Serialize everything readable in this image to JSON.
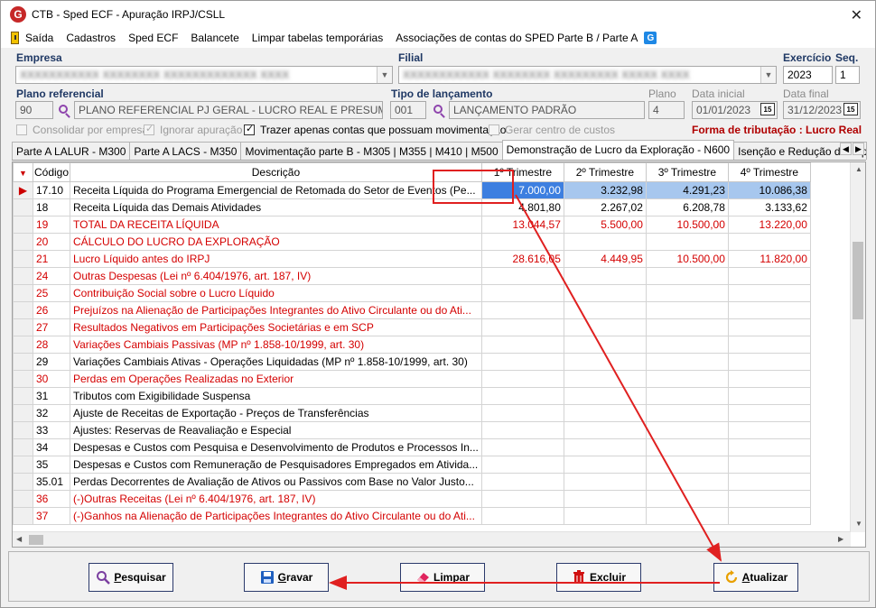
{
  "window": {
    "title": "CTB - Sped ECF - Apuração IRPJ/CSLL",
    "logo_letter": "G",
    "close_glyph": "✕"
  },
  "menu": {
    "items": [
      "Saída",
      "Cadastros",
      "Sped ECF",
      "Balancete",
      "Limpar tabelas temporárias",
      "Associações de contas do SPED Parte B / Parte A"
    ],
    "help_glyph": "G"
  },
  "form": {
    "empresa_label": "Empresa",
    "empresa_value": "XXXXXXXXXXX XXXXXXXX XXXXXXXXXXXXX XXXX",
    "filial_label": "Filial",
    "filial_value": "XXXXXXXXXXXX XXXXXXXX XXXXXXXXX XXXXX XXXX",
    "exercicio_label": "Exercício",
    "exercicio_value": "2023",
    "seq_label": "Seq.",
    "seq_value": "1",
    "plano_label": "Plano referencial",
    "plano_code": "90",
    "plano_desc": "PLANO REFERENCIAL PJ GERAL - LUCRO REAL E PRESUMIDO AN",
    "tipo_label": "Tipo de lançamento",
    "tipo_code": "001",
    "tipo_desc": "LANÇAMENTO PADRÃO",
    "plano2_label": "Plano",
    "plano2_value": "4",
    "data_inicial_label": "Data inicial",
    "data_inicial_value": "01/01/2023",
    "data_final_label": "Data final",
    "data_final_value": "31/12/2023",
    "cal_glyph": "15"
  },
  "checks": [
    {
      "label": "Consolidar por empresa",
      "state": "disabled-empty"
    },
    {
      "label": "Ignorar apuração",
      "state": "disabled-checked"
    },
    {
      "label": "Trazer apenas contas que possuam movimentação",
      "state": "checked"
    },
    {
      "label": "Gerar centro de custos",
      "state": "disabled-empty"
    }
  ],
  "forma_tributacao": "Forma de tributação : Lucro Real",
  "tabs": [
    "Parte A LALUR - M300",
    "Parte A LACS - M350",
    "Movimentação parte B - M305 | M355 | M410 | M500",
    "Demonstração de Lucro da Exploração - N600",
    "Isenção e Redução do Imposto Sobre o"
  ],
  "active_tab": 3,
  "grid": {
    "headers": [
      "Código",
      "Descrição",
      "1º Trimestre",
      "2º Trimestre",
      "3º Trimestre",
      "4º Trimestre"
    ],
    "rows": [
      {
        "code": "17.10",
        "desc": "Receita Líquida do Programa Emergencial de Retomada do Setor de Eventos (Pe...",
        "q1": "7.000,00",
        "q2": "3.232,98",
        "q3": "4.291,23",
        "q4": "10.086,38",
        "red": false,
        "selected": true
      },
      {
        "code": "18",
        "desc": "Receita Líquida das Demais Atividades",
        "q1": "4.801,80",
        "q2": "2.267,02",
        "q3": "6.208,78",
        "q4": "3.133,62",
        "red": false
      },
      {
        "code": "19",
        "desc": "TOTAL DA RECEITA LÍQUIDA",
        "q1": "13.044,57",
        "q2": "5.500,00",
        "q3": "10.500,00",
        "q4": "13.220,00",
        "red": true
      },
      {
        "code": "20",
        "desc": "CÁLCULO DO LUCRO DA EXPLORAÇÃO",
        "q1": "",
        "q2": "",
        "q3": "",
        "q4": "",
        "red": true
      },
      {
        "code": "21",
        "desc": "Lucro Líquido antes do IRPJ",
        "q1": "28.616,05",
        "q2": "4.449,95",
        "q3": "10.500,00",
        "q4": "11.820,00",
        "red": true
      },
      {
        "code": "24",
        "desc": "Outras Despesas (Lei nº 6.404/1976, art. 187, IV)",
        "q1": "",
        "q2": "",
        "q3": "",
        "q4": "",
        "red": true
      },
      {
        "code": "25",
        "desc": "Contribuição Social sobre o Lucro Líquido",
        "q1": "",
        "q2": "",
        "q3": "",
        "q4": "",
        "red": true
      },
      {
        "code": "26",
        "desc": "Prejuízos na Alienação de Participações Integrantes do Ativo Circulante ou do Ati...",
        "q1": "",
        "q2": "",
        "q3": "",
        "q4": "",
        "red": true
      },
      {
        "code": "27",
        "desc": "Resultados Negativos em Participações Societárias e em SCP",
        "q1": "",
        "q2": "",
        "q3": "",
        "q4": "",
        "red": true
      },
      {
        "code": "28",
        "desc": "Variações Cambiais Passivas (MP nº 1.858-10/1999, art. 30)",
        "q1": "",
        "q2": "",
        "q3": "",
        "q4": "",
        "red": true
      },
      {
        "code": "29",
        "desc": "Variações Cambiais Ativas - Operações Liquidadas (MP nº 1.858-10/1999, art. 30)",
        "q1": "",
        "q2": "",
        "q3": "",
        "q4": "",
        "red": false
      },
      {
        "code": "30",
        "desc": "Perdas em Operações Realizadas no Exterior",
        "q1": "",
        "q2": "",
        "q3": "",
        "q4": "",
        "red": true
      },
      {
        "code": "31",
        "desc": "Tributos com Exigibilidade Suspensa",
        "q1": "",
        "q2": "",
        "q3": "",
        "q4": "",
        "red": false
      },
      {
        "code": "32",
        "desc": "Ajuste de Receitas de Exportação - Preços de Transferências",
        "q1": "",
        "q2": "",
        "q3": "",
        "q4": "",
        "red": false
      },
      {
        "code": "33",
        "desc": "Ajustes: Reservas de Reavaliação e Especial",
        "q1": "",
        "q2": "",
        "q3": "",
        "q4": "",
        "red": false
      },
      {
        "code": "34",
        "desc": "Despesas e Custos com Pesquisa e Desenvolvimento de Produtos e Processos In...",
        "q1": "",
        "q2": "",
        "q3": "",
        "q4": "",
        "red": false
      },
      {
        "code": "35",
        "desc": "Despesas e Custos com Remuneração de Pesquisadores Empregados em Ativida...",
        "q1": "",
        "q2": "",
        "q3": "",
        "q4": "",
        "red": false
      },
      {
        "code": "35.01",
        "desc": "Perdas Decorrentes de Avaliação de Ativos ou Passivos com Base no Valor Justo...",
        "q1": "",
        "q2": "",
        "q3": "",
        "q4": "",
        "red": false
      },
      {
        "code": "36",
        "desc": "(-)Outras Receitas (Lei nº 6.404/1976, art. 187, IV)",
        "q1": "",
        "q2": "",
        "q3": "",
        "q4": "",
        "red": true
      },
      {
        "code": "37",
        "desc": "(-)Ganhos na Alienação de Participações Integrantes do Ativo Circulante ou do Ati...",
        "q1": "",
        "q2": "",
        "q3": "",
        "q4": "",
        "red": true
      }
    ]
  },
  "buttons": [
    {
      "name": "pesquisar-button",
      "first": "P",
      "rest": "esquisar",
      "icon": "search-icon"
    },
    {
      "name": "gravar-button",
      "first": "G",
      "rest": "ravar",
      "icon": "save-icon"
    },
    {
      "name": "limpar-button",
      "first": "L",
      "rest": "impar",
      "icon": "eraser-icon"
    },
    {
      "name": "excluir-button",
      "first": "E",
      "rest": "xcluir",
      "icon": "trash-icon"
    },
    {
      "name": "atualizar-button",
      "first": "A",
      "rest": "tualizar",
      "icon": "refresh-icon"
    }
  ],
  "colors": {
    "annotation": "#e02020",
    "selection": "#3d7fe0",
    "red_text": "#d40000",
    "label_blue": "#1f3864"
  }
}
